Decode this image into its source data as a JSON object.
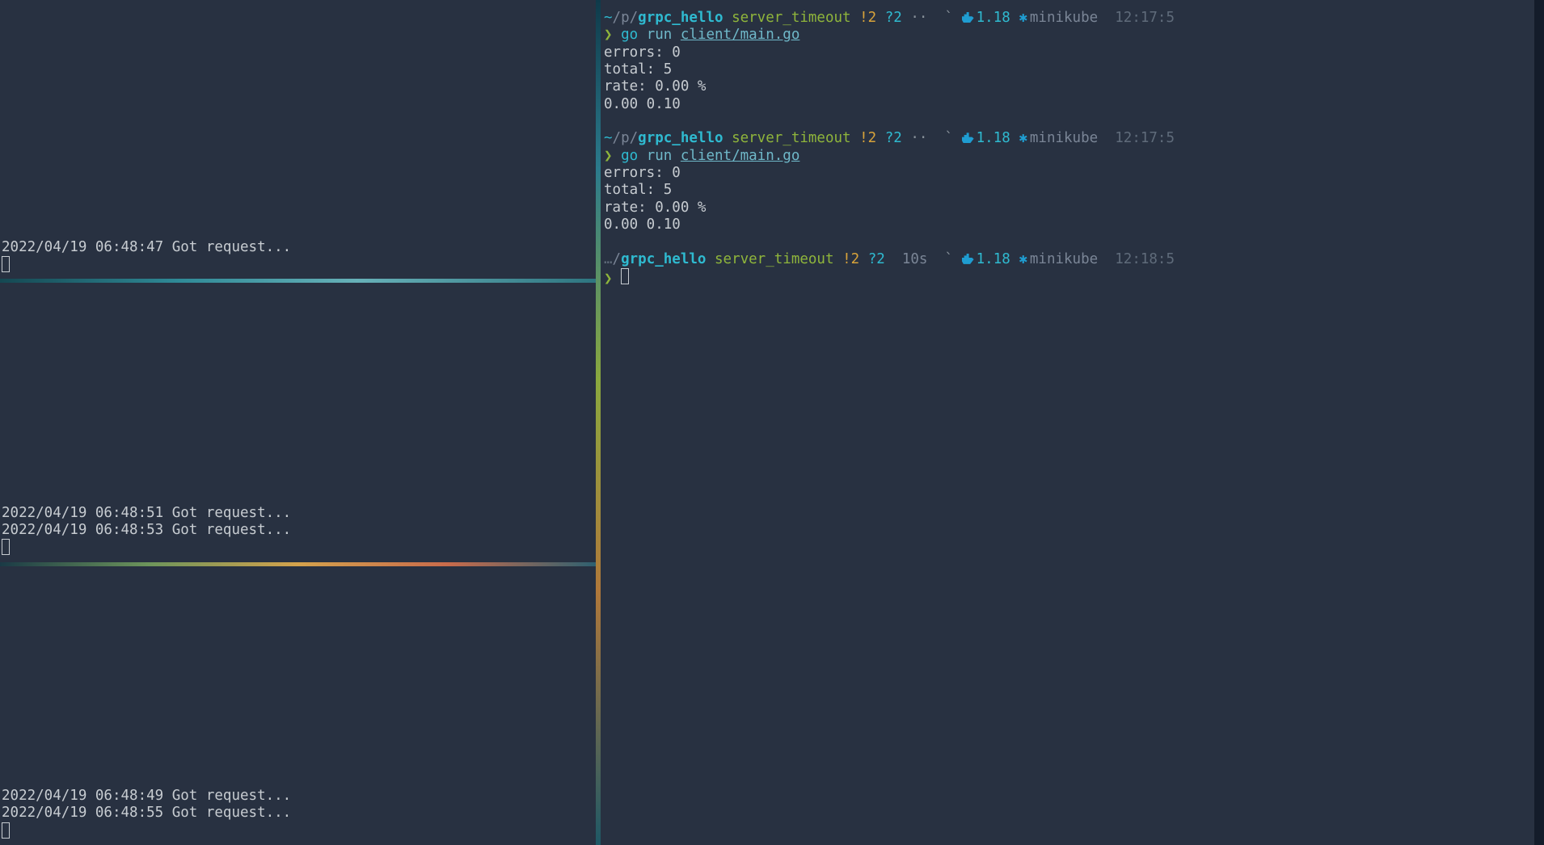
{
  "left_panes": [
    {
      "lines": [
        "2022/04/19 06:48:47 Got request..."
      ]
    },
    {
      "lines": [
        "2022/04/19 06:48:51 Got request...",
        "2022/04/19 06:48:53 Got request..."
      ]
    },
    {
      "lines": [
        "2022/04/19 06:48:49 Got request...",
        "2022/04/19 06:48:55 Got request..."
      ]
    }
  ],
  "right": {
    "blocks": [
      {
        "prompt": {
          "prefix": "~/p/",
          "dir": "grpc_hello",
          "branch": "server_timeout",
          "bang": "!2",
          "q": "?2",
          "dots": "··",
          "docker_ver": "1.18",
          "kube_ctx": "minikube",
          "time": "12:17:5",
          "duration": ""
        },
        "command": {
          "go": "go",
          "sub": "run",
          "path": "client/main.go"
        },
        "output": [
          "errors: 0",
          "total: 5",
          "rate: 0.00 %",
          "0.00 0.10"
        ]
      },
      {
        "prompt": {
          "prefix": "~/p/",
          "dir": "grpc_hello",
          "branch": "server_timeout",
          "bang": "!2",
          "q": "?2",
          "dots": "··",
          "docker_ver": "1.18",
          "kube_ctx": "minikube",
          "time": "12:17:5",
          "duration": ""
        },
        "command": {
          "go": "go",
          "sub": "run",
          "path": "client/main.go"
        },
        "output": [
          "errors: 0",
          "total: 5",
          "rate: 0.00 %",
          "0.00 0.10"
        ]
      },
      {
        "prompt": {
          "prefix": "…/",
          "dir": "grpc_hello",
          "branch": "server_timeout",
          "bang": "!2",
          "q": "?2",
          "dots": "",
          "docker_ver": "1.18",
          "kube_ctx": "minikube",
          "time": "12:18:5",
          "duration": "10s"
        },
        "command": null,
        "output": []
      }
    ]
  }
}
